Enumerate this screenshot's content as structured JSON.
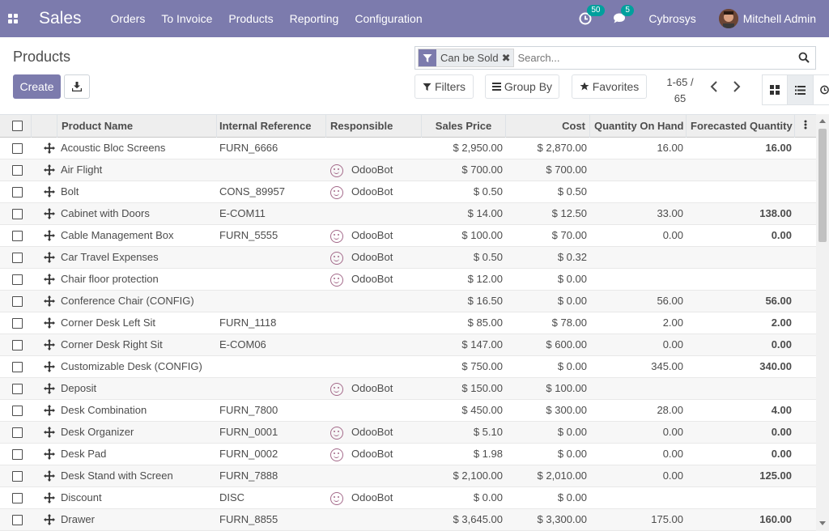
{
  "navbar": {
    "app_title": "Sales",
    "menu": [
      "Orders",
      "To Invoice",
      "Products",
      "Reporting",
      "Configuration"
    ],
    "activity_count": "50",
    "message_count": "5",
    "company": "Cybrosys",
    "user": "Mitchell Admin"
  },
  "breadcrumb": "Products",
  "search": {
    "facet": "Can be Sold",
    "placeholder": "Search..."
  },
  "buttons": {
    "create": "Create",
    "filters": "Filters",
    "group_by": "Group By",
    "favorites": "Favorites"
  },
  "pager": {
    "range": "1-65 /",
    "total": "65"
  },
  "columns": [
    "Product Name",
    "Internal Reference",
    "Responsible",
    "Sales Price",
    "Cost",
    "Quantity On Hand",
    "Forecasted Quantity"
  ],
  "rows": [
    {
      "name": "Acoustic Bloc Screens",
      "ref": "FURN_6666",
      "resp": "",
      "price": "$ 2,950.00",
      "cost": "$ 2,870.00",
      "onhand": "16.00",
      "forecast": "16.00"
    },
    {
      "name": "Air Flight",
      "ref": "",
      "resp": "OdooBot",
      "price": "$ 700.00",
      "cost": "$ 700.00",
      "onhand": "",
      "forecast": ""
    },
    {
      "name": "Bolt",
      "ref": "CONS_89957",
      "resp": "OdooBot",
      "price": "$ 0.50",
      "cost": "$ 0.50",
      "onhand": "",
      "forecast": ""
    },
    {
      "name": "Cabinet with Doors",
      "ref": "E-COM11",
      "resp": "",
      "price": "$ 14.00",
      "cost": "$ 12.50",
      "onhand": "33.00",
      "forecast": "138.00"
    },
    {
      "name": "Cable Management Box",
      "ref": "FURN_5555",
      "resp": "OdooBot",
      "price": "$ 100.00",
      "cost": "$ 70.00",
      "onhand": "0.00",
      "forecast": "0.00"
    },
    {
      "name": "Car Travel Expenses",
      "ref": "",
      "resp": "OdooBot",
      "price": "$ 0.50",
      "cost": "$ 0.32",
      "onhand": "",
      "forecast": ""
    },
    {
      "name": "Chair floor protection",
      "ref": "",
      "resp": "OdooBot",
      "price": "$ 12.00",
      "cost": "$ 0.00",
      "onhand": "",
      "forecast": ""
    },
    {
      "name": "Conference Chair (CONFIG)",
      "ref": "",
      "resp": "",
      "price": "$ 16.50",
      "cost": "$ 0.00",
      "onhand": "56.00",
      "forecast": "56.00"
    },
    {
      "name": "Corner Desk Left Sit",
      "ref": "FURN_1118",
      "resp": "",
      "price": "$ 85.00",
      "cost": "$ 78.00",
      "onhand": "2.00",
      "forecast": "2.00"
    },
    {
      "name": "Corner Desk Right Sit",
      "ref": "E-COM06",
      "resp": "",
      "price": "$ 147.00",
      "cost": "$ 600.00",
      "onhand": "0.00",
      "forecast": "0.00"
    },
    {
      "name": "Customizable Desk (CONFIG)",
      "ref": "",
      "resp": "",
      "price": "$ 750.00",
      "cost": "$ 0.00",
      "onhand": "345.00",
      "forecast": "340.00"
    },
    {
      "name": "Deposit",
      "ref": "",
      "resp": "OdooBot",
      "price": "$ 150.00",
      "cost": "$ 100.00",
      "onhand": "",
      "forecast": ""
    },
    {
      "name": "Desk Combination",
      "ref": "FURN_7800",
      "resp": "",
      "price": "$ 450.00",
      "cost": "$ 300.00",
      "onhand": "28.00",
      "forecast": "4.00"
    },
    {
      "name": "Desk Organizer",
      "ref": "FURN_0001",
      "resp": "OdooBot",
      "price": "$ 5.10",
      "cost": "$ 0.00",
      "onhand": "0.00",
      "forecast": "0.00"
    },
    {
      "name": "Desk Pad",
      "ref": "FURN_0002",
      "resp": "OdooBot",
      "price": "$ 1.98",
      "cost": "$ 0.00",
      "onhand": "0.00",
      "forecast": "0.00"
    },
    {
      "name": "Desk Stand with Screen",
      "ref": "FURN_7888",
      "resp": "",
      "price": "$ 2,100.00",
      "cost": "$ 2,010.00",
      "onhand": "0.00",
      "forecast": "125.00"
    },
    {
      "name": "Discount",
      "ref": "DISC",
      "resp": "OdooBot",
      "price": "$ 0.00",
      "cost": "$ 0.00",
      "onhand": "",
      "forecast": ""
    },
    {
      "name": "Drawer",
      "ref": "FURN_8855",
      "resp": "",
      "price": "$ 3,645.00",
      "cost": "$ 3,300.00",
      "onhand": "175.00",
      "forecast": "160.00"
    }
  ]
}
